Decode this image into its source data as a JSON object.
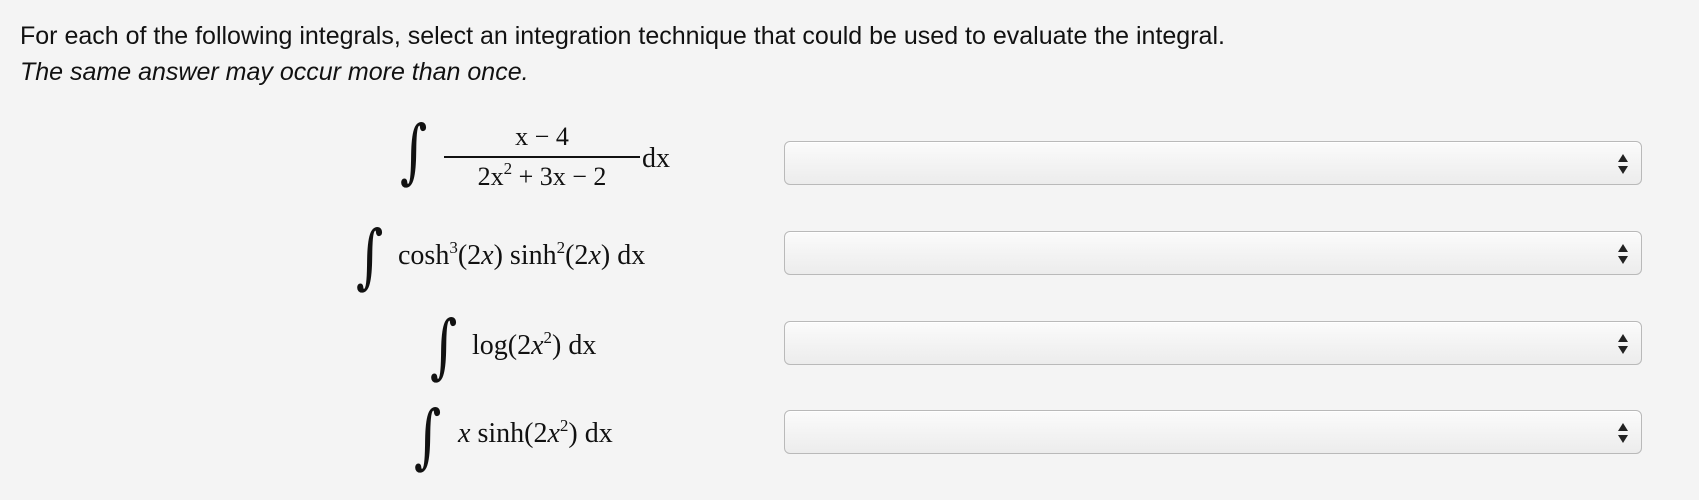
{
  "instructions": {
    "line1": "For each of the following integrals, select an integration technique that could be used to evaluate the integral.",
    "line2": "The same answer may occur more than once."
  },
  "integrals": [
    {
      "numerator": "x − 4",
      "denominator_a": "2x",
      "denominator_exp": "2",
      "denominator_b": " + 3x − 2",
      "differential": "dx"
    },
    {
      "fn1": "cosh",
      "fn1_exp": "3",
      "arg1": "(2",
      "arg1_var": "x",
      "arg1_end": ")",
      "fn2": "sinh",
      "fn2_exp": "2",
      "arg2": "(2",
      "arg2_var": "x",
      "arg2_end": ")",
      "differential": "dx"
    },
    {
      "fn": "log",
      "open": "(2",
      "var": "x",
      "exp": "2",
      "close": ")",
      "differential": "dx"
    },
    {
      "var": "x",
      "fn": "sinh",
      "open": "(2",
      "inner_var": "x",
      "exp": "2",
      "close": ")",
      "differential": "dx"
    }
  ],
  "dropdowns": [
    {
      "value": "",
      "arrow_icon": "up-down-arrows-icon"
    },
    {
      "value": "",
      "arrow_icon": "up-down-arrows-icon"
    },
    {
      "value": "",
      "arrow_icon": "up-down-arrows-icon"
    },
    {
      "value": "",
      "arrow_icon": "up-down-arrows-icon"
    }
  ],
  "colors": {
    "background": "#f4f4f4",
    "select_border": "#b9b9b9",
    "text": "#111111"
  }
}
